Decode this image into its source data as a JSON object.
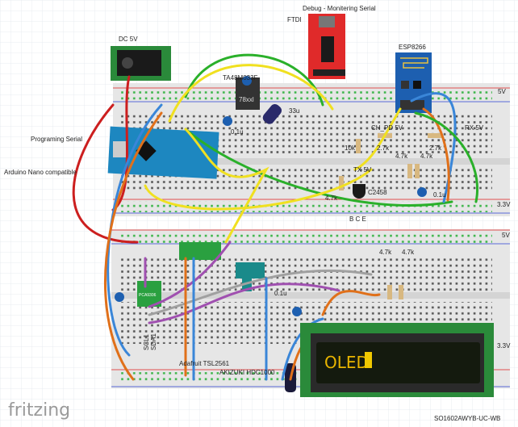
{
  "title": "fritzing",
  "labels": {
    "dc_jack": "DC 5V",
    "ftdi": "FTDI",
    "ftdi_purpose": "Debug - Monitering Serial",
    "esp": "ESP8266",
    "regulator": "TA48M033F",
    "regulator_chip": "78xxl",
    "cap_33u": "33u",
    "cap_reg": "0.1u",
    "prog_serial": "Programing Serial",
    "nano": "Arduino Nano compatible",
    "ch_pd": "CH_PD 5V",
    "rx": "RX 5V",
    "tx": "TX 5V",
    "r10k": "10k",
    "r27k_a": "2.7k",
    "r27k_b": "2.7k",
    "r47k_a": "4.7k",
    "r47k_b": "4.7k",
    "r47k_c": "4.7k",
    "transistor": "C2458",
    "bce": "B  C  E",
    "cap_esp": "0.1u",
    "rail_5v_top": "5V",
    "rail_33v_top": "3.3V",
    "rail_5v_bottom": "5V",
    "rail_33v_bottom": "3.3V",
    "r47k_d": "4.7k",
    "r47k_e": "4.7k",
    "cap_bottom": "0.1u",
    "pca": "PCA9306",
    "scl": "SCL1",
    "sda": "SDA1",
    "tsl": "Adafruit TSL2561",
    "hdc": "AKIZUKI HDC1000",
    "oled_model": "SO1602AWYB-UC-WB",
    "oled_text": "OLED"
  },
  "colors": {
    "breadboard": "#e6e6e6",
    "rail_red": "#e05050",
    "rail_blue": "#5a6ad8",
    "hole_green": "#3cb54a",
    "wire_green": "#2ab02a",
    "wire_yellow": "#f0e020",
    "wire_red": "#cc1f1f",
    "wire_blue": "#3a86d8",
    "wire_orange": "#e0701a",
    "wire_purple": "#a050b0",
    "wire_gray": "#a0a0a0",
    "ftdi_red": "#e02a2a",
    "esp_blue": "#1d5fb0",
    "nano_blue": "#1d87c0",
    "pcb_green": "#2a8a3a",
    "oled_text": "#e8b400"
  }
}
